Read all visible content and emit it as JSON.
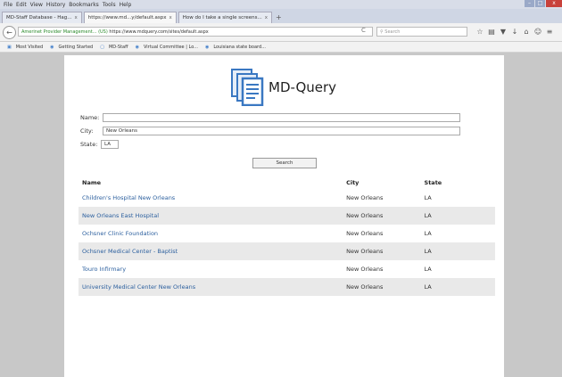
{
  "browser": {
    "menu": [
      "File",
      "Edit",
      "View",
      "History",
      "Bookmarks",
      "Tools",
      "Help"
    ],
    "window_controls": [
      "–",
      "□",
      "x"
    ],
    "tabs": [
      {
        "label": "MD-Staff Database - Hag...",
        "close": "x"
      },
      {
        "label": "https://www.md...y/default.aspx",
        "close": "x"
      },
      {
        "label": "How do I take a single screens...",
        "close": "x"
      }
    ],
    "new_tab": "+",
    "back": "←",
    "url_site": "Amerinet Provider Management... (US)",
    "url_path": "https://www.mdquery.com/sites/default.aspx",
    "reload": "C",
    "search_placeholder": "Search",
    "toolbar_icons": [
      "☆",
      "▤",
      "▼",
      "↓",
      "⌂",
      "☺",
      "≡"
    ],
    "bookmarks": [
      "Most Visited",
      "Getting Started",
      "MD-Staff",
      "Virtual Committee | Lo...",
      "Louisiana state board..."
    ]
  },
  "app": {
    "title": "MD-Query",
    "form": {
      "name_label": "Name:",
      "name_value": "",
      "city_label": "City:",
      "city_value": "New Orleans",
      "state_label": "State:",
      "state_value": "LA",
      "search_button": "Search"
    },
    "table": {
      "headers": [
        "Name",
        "City",
        "State"
      ],
      "rows": [
        [
          "Children's Hospital New Orleans",
          "New Orleans",
          "LA"
        ],
        [
          "New Orleans East Hospital",
          "New Orleans",
          "LA"
        ],
        [
          "Ochsner Clinic Foundation",
          "New Orleans",
          "LA"
        ],
        [
          "Ochsner Medical Center - Baptist",
          "New Orleans",
          "LA"
        ],
        [
          "Touro Infirmary",
          "New Orleans",
          "LA"
        ],
        [
          "University Medical Center New Orleans",
          "New Orleans",
          "LA"
        ]
      ]
    }
  },
  "colors": {
    "link": "#2b5f9e",
    "stripe": "#e9e9e9",
    "logo_blue": "#3a78c2",
    "chrome": "#f2f2f2",
    "desktop_gray": "#c8c8c8"
  }
}
